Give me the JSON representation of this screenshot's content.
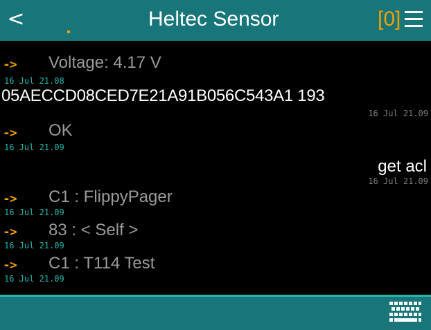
{
  "header": {
    "back_label": "<",
    "title": "Heltec Sensor",
    "unread_badge": "[0]",
    "menu_icon": "menu-icon",
    "colors": {
      "bar": "#18757a",
      "accent": "#f0a000"
    }
  },
  "messages": [
    {
      "arrow": "->",
      "text": "Voltage: 4.17 V",
      "timestamp": "16 Jul 21.08"
    },
    {
      "text": "05AECCD08CED7E21A91B056C543A1 193",
      "timestamp": "16 Jul 21.09"
    },
    {
      "arrow": "->",
      "text": "OK",
      "timestamp": "16 Jul 21.09"
    },
    {
      "text": "get acl",
      "timestamp": "16 Jul 21.09"
    },
    {
      "arrow": "->",
      "text": "C1 : FlippyPager",
      "timestamp": "16 Jul 21.09"
    },
    {
      "arrow": "->",
      "text": "83 : < Self >",
      "timestamp": "16 Jul 21.09"
    },
    {
      "arrow": "->",
      "text": "C1 : T114 Test",
      "timestamp": "16 Jul 21.09"
    }
  ],
  "footer": {
    "keyboard_icon": "keyboard-icon"
  }
}
